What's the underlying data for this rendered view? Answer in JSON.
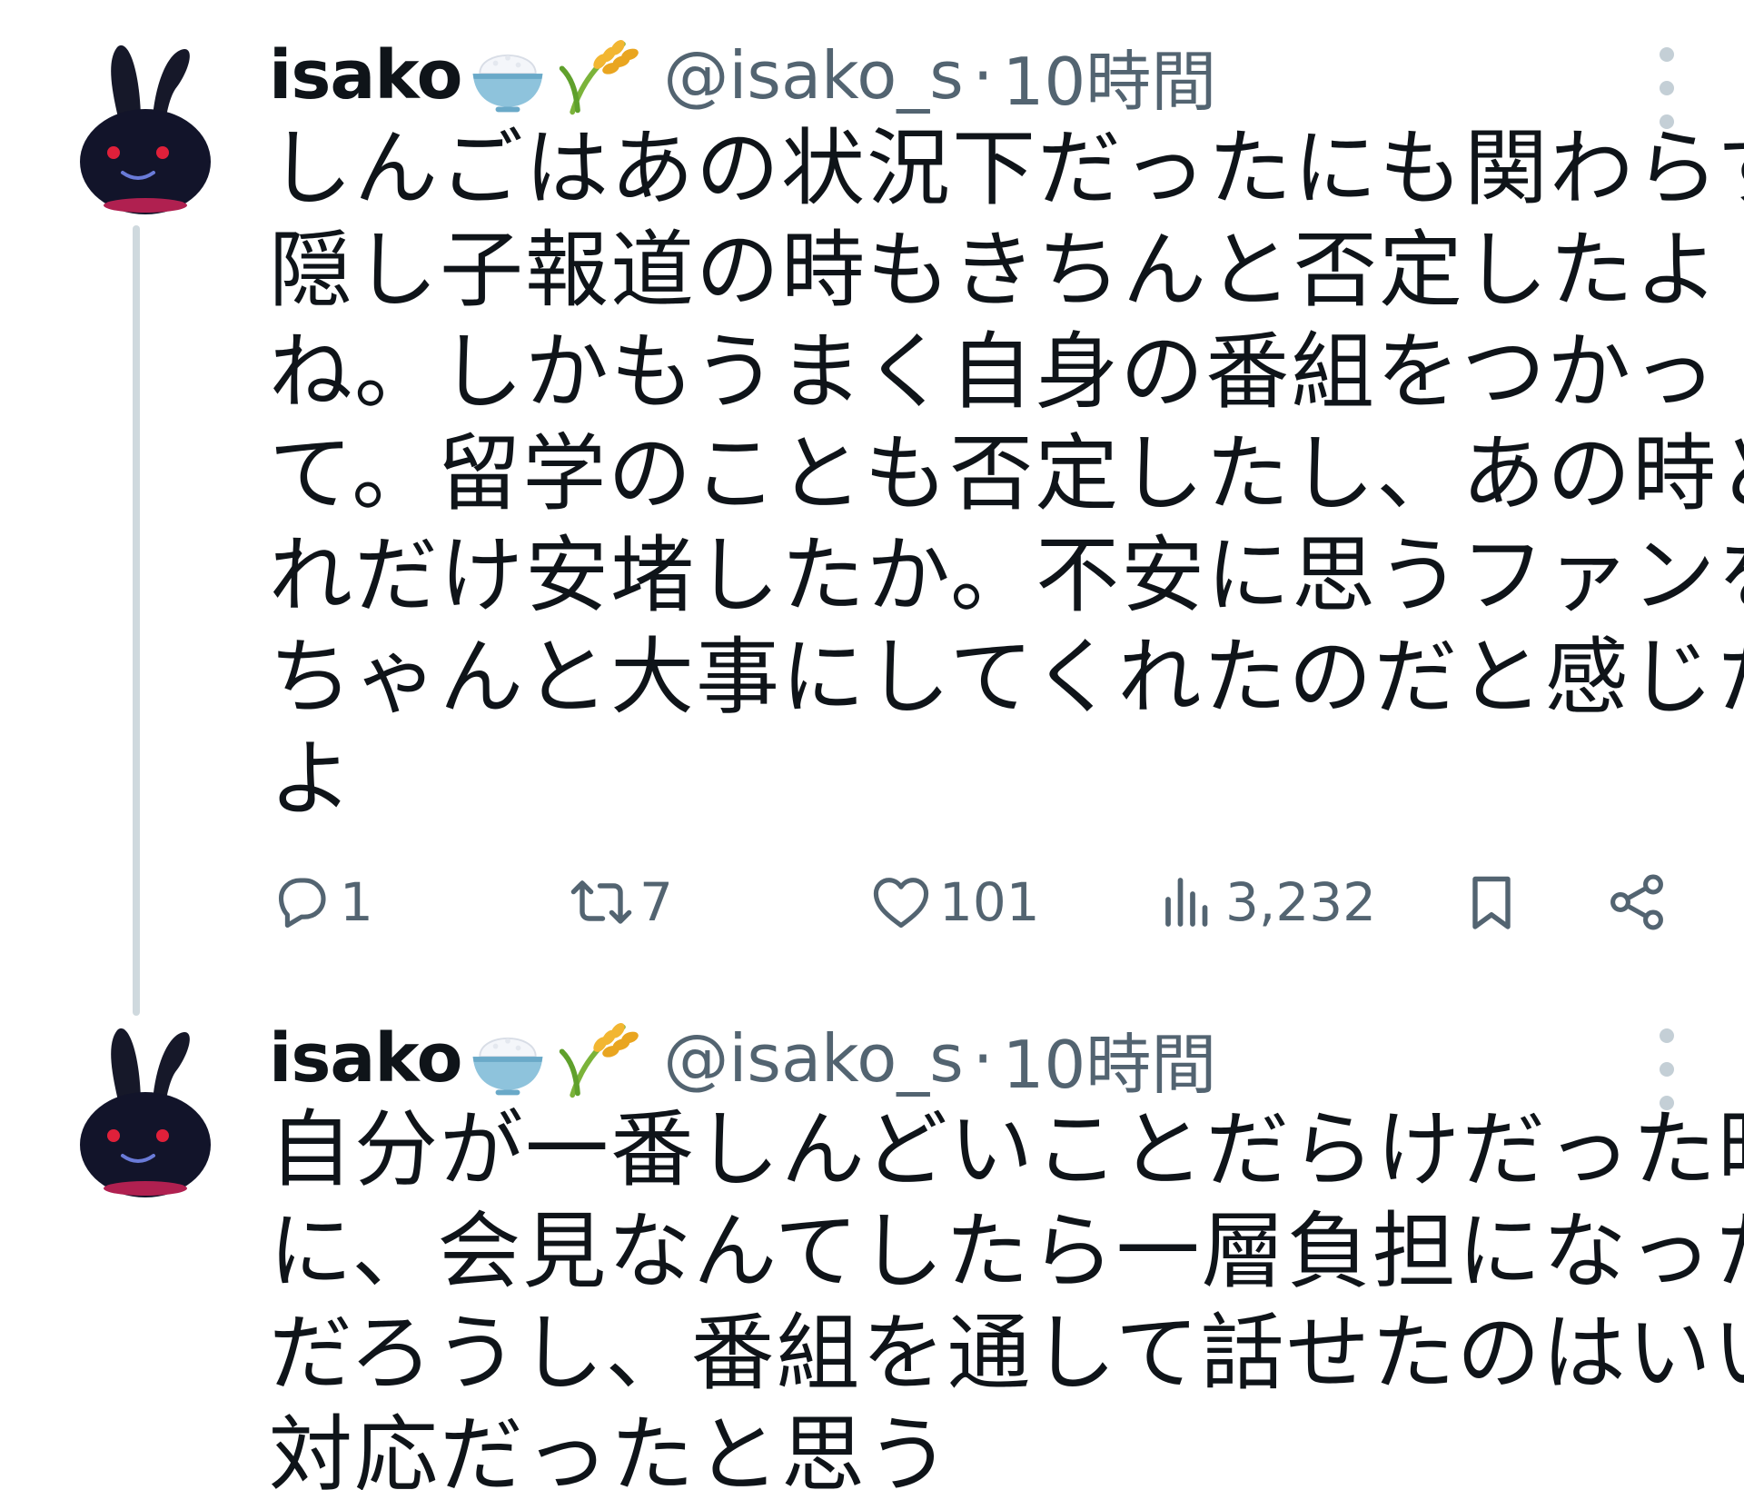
{
  "tweets": [
    {
      "user": {
        "display_name": "isako",
        "emojis": [
          "rice-bowl-icon",
          "rice-plant-icon"
        ],
        "handle": "@isako_s",
        "separator": "·",
        "time": "10時間"
      },
      "lines": [
        "しんごはあの状況下だったにも関わらず",
        "隠し子報道の時もきちんと否定したよ",
        "ね。しかもうまく自身の番組をつかっ",
        "て。留学のことも否定したし、あの時ど",
        "れだけ安堵したか。不安に思うファンを",
        "ちゃんと大事にしてくれたのだと感じた",
        "よ"
      ],
      "metrics": {
        "replies": "1",
        "retweets": "7",
        "likes": "101",
        "views": "3,232"
      }
    },
    {
      "user": {
        "display_name": "isako",
        "emojis": [
          "rice-bowl-icon",
          "rice-plant-icon"
        ],
        "handle": "@isako_s",
        "separator": "·",
        "time": "10時間"
      },
      "lines": [
        "自分が一番しんどいことだらけだった時",
        "に、会見なんてしたら一層負担になった",
        "だろうし、番組を通して話せたのはいい",
        "対応だったと思う"
      ]
    }
  ],
  "colors": {
    "text": "#0f1419",
    "secondary": "#536471",
    "thread_line": "#cfd9de",
    "more_dots": "#c4cfd6"
  }
}
